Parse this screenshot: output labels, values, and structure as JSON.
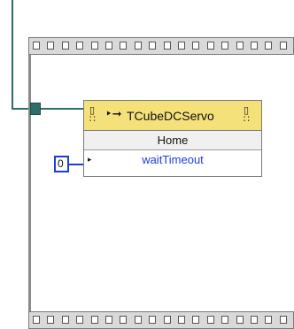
{
  "node": {
    "class_name": "TCubeDCServo",
    "method": "Home",
    "parameter": "waitTimeout"
  },
  "constant": {
    "value": "0"
  },
  "icons": {
    "left_ref": "property-ref-icon",
    "arrow": "invoke-arrow-icon",
    "right_ref": "property-ref-icon"
  },
  "colors": {
    "wire": "#2d6e6a",
    "header": "#f5e17a",
    "integer_wire": "#1d3ce0"
  }
}
